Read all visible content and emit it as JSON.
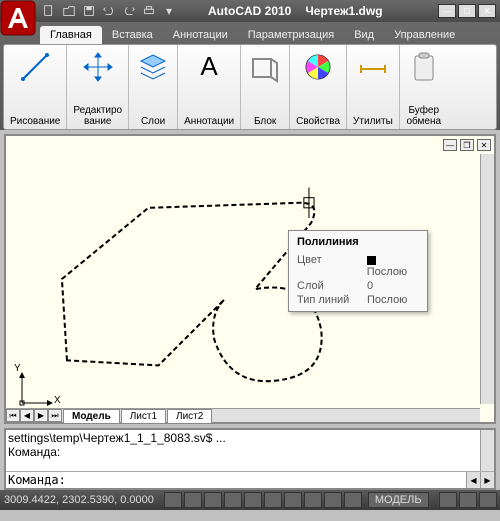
{
  "app": {
    "name": "AutoCAD 2010",
    "doc": "Чертеж1.dwg"
  },
  "ribbon": {
    "tabs": [
      "Главная",
      "Вставка",
      "Аннотации",
      "Параметризация",
      "Вид",
      "Управление"
    ],
    "active": 0,
    "panels": [
      {
        "label": "Рисование",
        "icon": "line-icon"
      },
      {
        "label": "Редактиро\nвание",
        "icon": "move-icon"
      },
      {
        "label": "Слои",
        "icon": "layers-icon"
      },
      {
        "label": "Аннотации",
        "icon": "text-icon"
      },
      {
        "label": "Блок",
        "icon": "block-icon"
      },
      {
        "label": "Свойства",
        "icon": "color-wheel-icon"
      },
      {
        "label": "Утилиты",
        "icon": "measure-icon"
      },
      {
        "label": "Буфер\nобмена",
        "icon": "clipboard-icon"
      }
    ]
  },
  "drawing": {
    "sheets": [
      "Модель",
      "Лист1",
      "Лист2"
    ],
    "active_sheet": 0,
    "ucs": {
      "x": "X",
      "y": "Y"
    }
  },
  "tooltip": {
    "title": "Полилиния",
    "rows": [
      {
        "k": "Цвет",
        "v": "Послою",
        "swatch": true
      },
      {
        "k": "Слой",
        "v": "0"
      },
      {
        "k": "Тип линий",
        "v": "Послою"
      }
    ]
  },
  "command": {
    "history": "settings\\temp\\Чертеж1_1_1_8083.sv$ ...\nКоманда:",
    "prompt": "Команда:"
  },
  "status": {
    "coords": "3009.4422, 2302.5390, 0.0000",
    "model": "МОДЕЛЬ"
  }
}
